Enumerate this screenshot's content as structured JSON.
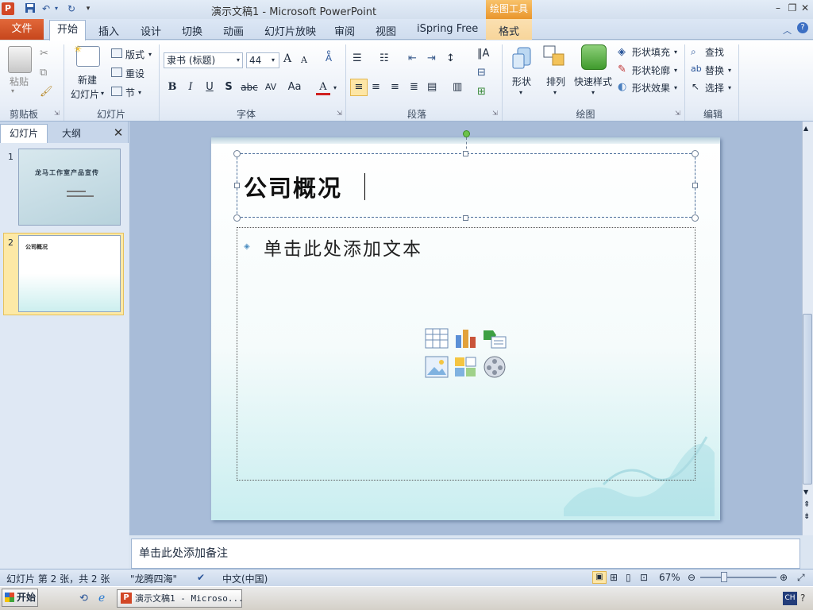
{
  "window": {
    "app_icon_letter": "P",
    "title": "演示文稿1 - Microsoft PowerPoint",
    "context_tab_header": "绘图工具"
  },
  "tabs": {
    "file": "文件",
    "home": "开始",
    "insert": "插入",
    "design": "设计",
    "transitions": "切换",
    "animations": "动画",
    "slideshow": "幻灯片放映",
    "review": "审阅",
    "view": "视图",
    "ispring": "iSpring Free",
    "format": "格式"
  },
  "ribbon": {
    "clipboard": {
      "paste": "粘贴",
      "group": "剪贴板"
    },
    "slides": {
      "new_slide_line1": "新建",
      "new_slide_line2": "幻灯片",
      "layout": "版式",
      "reset": "重设",
      "section": "节",
      "group": "幻灯片"
    },
    "font": {
      "font_name": "隶书 (标题)",
      "font_size": "44",
      "bold": "B",
      "italic": "I",
      "underline": "U",
      "shadow": "S",
      "strike": "abc",
      "spacing": "AV",
      "case": "Aa",
      "color": "A",
      "grow": "A",
      "shrink": "A",
      "group": "字体"
    },
    "paragraph": {
      "group": "段落"
    },
    "drawing": {
      "shapes": "形状",
      "arrange": "排列",
      "quick_styles": "快速样式",
      "shape_fill": "形状填充",
      "shape_outline": "形状轮廓",
      "shape_effects": "形状效果",
      "group": "绘图"
    },
    "editing": {
      "find": "查找",
      "replace": "替换",
      "select": "选择",
      "group": "编辑"
    }
  },
  "left_pane": {
    "tab_slides": "幻灯片",
    "tab_outline": "大纲",
    "close": "✕",
    "thumbs": [
      {
        "num": "1",
        "title": "龙马工作室产品宣传"
      },
      {
        "num": "2",
        "title": "公司概况"
      }
    ]
  },
  "slide": {
    "title": "公司概况",
    "content_placeholder": "单击此处添加文本"
  },
  "notes": {
    "placeholder": "单击此处添加备注"
  },
  "status": {
    "slide_info": "幻灯片 第 2 张，共 2 张",
    "theme": "\"龙腾四海\"",
    "language": "中文(中国)",
    "zoom": "67%",
    "zoom_level": 0.67
  },
  "taskbar": {
    "start": "开始",
    "ppt_task": "演示文稿1 - Microso...",
    "lang": "CH"
  },
  "colors": {
    "file_tab": "#c6461c",
    "context_accent": "#e9962c",
    "thumb_selected": "#fde9a6"
  }
}
